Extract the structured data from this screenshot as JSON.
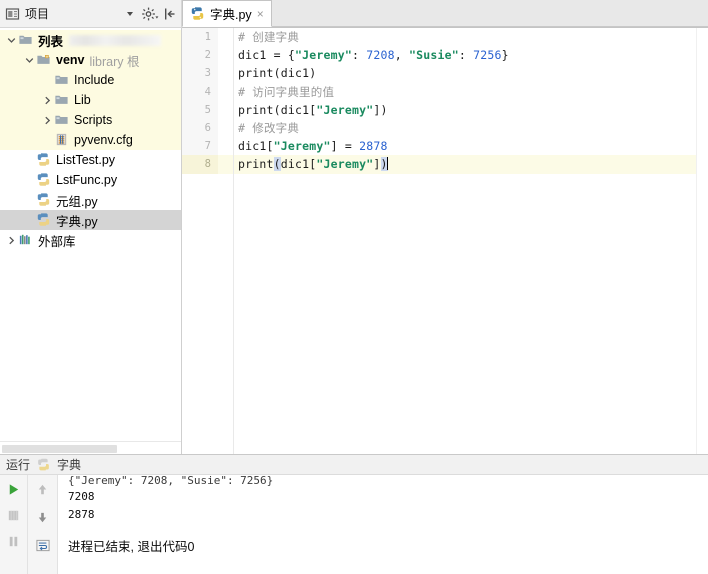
{
  "project_toolbar": {
    "title": "项目",
    "icons": [
      "project-view-icon",
      "chevron-down-icon",
      "gear-icon",
      "collapse-all-icon"
    ]
  },
  "editor_tabs": [
    {
      "label": "字典.py",
      "icon": "python-file-icon",
      "close": "×",
      "active": true
    }
  ],
  "sidebar": {
    "items": [
      {
        "label": "列表",
        "sublabel": "",
        "icon": "folder-project-icon",
        "indent": 0,
        "twisty": "down",
        "bold": true,
        "state": "expanded",
        "highlight": "yellow",
        "redacted": true
      },
      {
        "label": "venv",
        "sublabel": "library 根",
        "icon": "folder-venv-icon",
        "indent": 1,
        "twisty": "down",
        "bold": true,
        "state": "expanded",
        "highlight": "yellow",
        "redacted": false
      },
      {
        "label": "Include",
        "sublabel": "",
        "icon": "folder-icon",
        "indent": 2,
        "twisty": "none",
        "bold": false,
        "state": "leaf",
        "highlight": "yellow",
        "redacted": false
      },
      {
        "label": "Lib",
        "sublabel": "",
        "icon": "folder-icon",
        "indent": 2,
        "twisty": "right",
        "bold": false,
        "state": "collapsed",
        "highlight": "yellow",
        "redacted": false
      },
      {
        "label": "Scripts",
        "sublabel": "",
        "icon": "folder-icon",
        "indent": 2,
        "twisty": "right",
        "bold": false,
        "state": "collapsed",
        "highlight": "yellow",
        "redacted": false
      },
      {
        "label": "pyvenv.cfg",
        "sublabel": "",
        "icon": "config-file-icon",
        "indent": 2,
        "twisty": "none",
        "bold": false,
        "state": "leaf",
        "highlight": "yellow",
        "redacted": false
      },
      {
        "label": "ListTest.py",
        "sublabel": "",
        "icon": "python-file-icon",
        "indent": 1,
        "twisty": "none",
        "bold": false,
        "state": "leaf",
        "highlight": "none",
        "redacted": false
      },
      {
        "label": "LstFunc.py",
        "sublabel": "",
        "icon": "python-file-icon",
        "indent": 1,
        "twisty": "none",
        "bold": false,
        "state": "leaf",
        "highlight": "none",
        "redacted": false
      },
      {
        "label": "元组.py",
        "sublabel": "",
        "icon": "python-file-icon",
        "indent": 1,
        "twisty": "none",
        "bold": false,
        "state": "leaf",
        "highlight": "none",
        "redacted": false
      },
      {
        "label": "字典.py",
        "sublabel": "",
        "icon": "python-file-icon",
        "indent": 1,
        "twisty": "none",
        "bold": false,
        "state": "selected",
        "highlight": "selected",
        "redacted": false
      },
      {
        "label": "外部库",
        "sublabel": "",
        "icon": "external-libraries-icon",
        "indent": 0,
        "twisty": "right",
        "bold": false,
        "state": "collapsed",
        "highlight": "none",
        "redacted": false
      }
    ]
  },
  "code": {
    "language": "python",
    "current_line": 8,
    "lines": [
      {
        "n": "1",
        "raw": "# 创建字典"
      },
      {
        "n": "2",
        "raw": "dic1 = {\"Jeremy\": 7208, \"Susie\": 7256}"
      },
      {
        "n": "3",
        "raw": "print(dic1)"
      },
      {
        "n": "4",
        "raw": "# 访问字典里的值"
      },
      {
        "n": "5",
        "raw": "print(dic1[\"Jeremy\"])"
      },
      {
        "n": "6",
        "raw": "# 修改字典"
      },
      {
        "n": "7",
        "raw": "dic1[\"Jeremy\"] = 2878"
      },
      {
        "n": "8",
        "raw": "print(dic1[\"Jeremy\"])"
      }
    ]
  },
  "run_panel": {
    "tab_label": "运行",
    "config_name": "字典",
    "tools": [
      "run-icon",
      "stop-icon",
      "pause-icon",
      "scroll-up-icon",
      "scroll-down-icon",
      "soft-wrap-icon"
    ],
    "output": [
      "{\"Jeremy\": 7208, \"Susie\": 7256}",
      "7208",
      "2878",
      "",
      "进程已结束, 退出代码0"
    ]
  },
  "colors": {
    "string": "#1a8a5f",
    "number": "#2a62d0",
    "comment": "#9a9a9a",
    "current_line_bg": "#fcfbe6",
    "tree_highlight_bg": "#fdfbe1",
    "tree_selected_bg": "#d4d4d4",
    "run_green": "#3aa33a",
    "panel_bg": "#f1f1f1"
  }
}
